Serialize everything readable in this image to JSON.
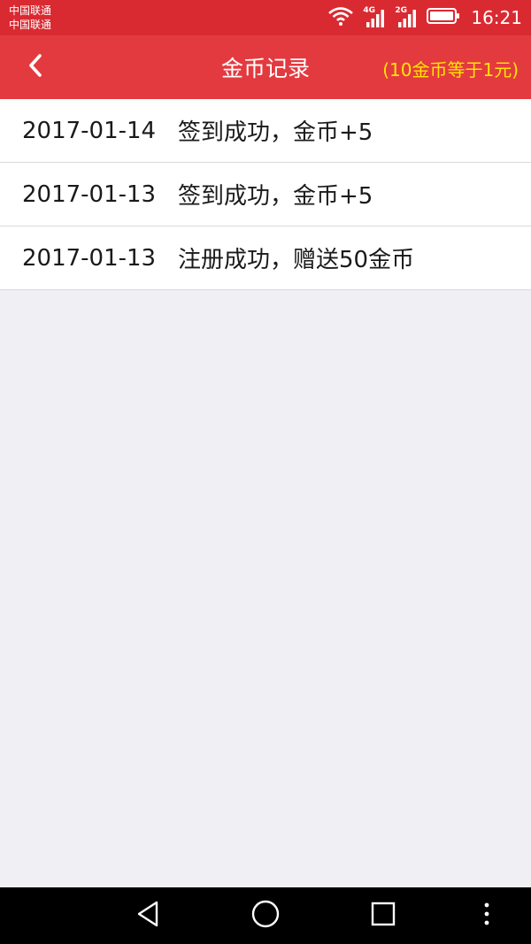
{
  "status_bar": {
    "carrier_1": "中国联通",
    "carrier_2": "中国联通",
    "network_1": "4G",
    "network_2": "2G",
    "time": "16:21",
    "icons": [
      "wifi-icon",
      "signal-icon",
      "signal-icon",
      "battery-icon"
    ]
  },
  "header": {
    "title": "金币记录",
    "note": "(10金币等于1元)",
    "back_icon": "chevron-left-icon"
  },
  "records": [
    {
      "date": "2017-01-14",
      "desc": "签到成功，金币+5"
    },
    {
      "date": "2017-01-13",
      "desc": "签到成功，金币+5"
    },
    {
      "date": "2017-01-13",
      "desc": "注册成功，赠送50金币"
    }
  ],
  "system_nav": {
    "icons": [
      "back-triangle-icon",
      "home-circle-icon",
      "recents-square-icon",
      "more-dots-icon"
    ]
  },
  "colors": {
    "status_bar": "#da2a31",
    "header": "#e33a3f",
    "note": "#ffe600",
    "background": "#efeff4"
  }
}
